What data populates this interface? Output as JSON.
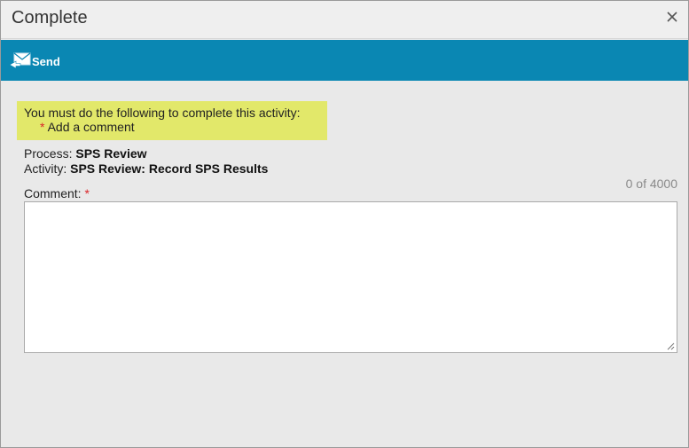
{
  "dialog": {
    "title": "Complete",
    "close_icon": "close-icon"
  },
  "toolbar": {
    "send_label": "Send",
    "send_icon": "send-mail-icon",
    "color": "#0a87b3"
  },
  "notice": {
    "heading": "You must do the following to complete this activity:",
    "requirement_marker": "*",
    "requirement": "Add a comment",
    "highlight_color": "#e2e86a"
  },
  "info": {
    "process_label": "Process:",
    "process_value": "SPS Review",
    "activity_label": "Activity:",
    "activity_value": "SPS Review: Record SPS Results"
  },
  "comment": {
    "label": "Comment:",
    "required_marker": "*",
    "counter": "0 of 4000",
    "value": ""
  }
}
